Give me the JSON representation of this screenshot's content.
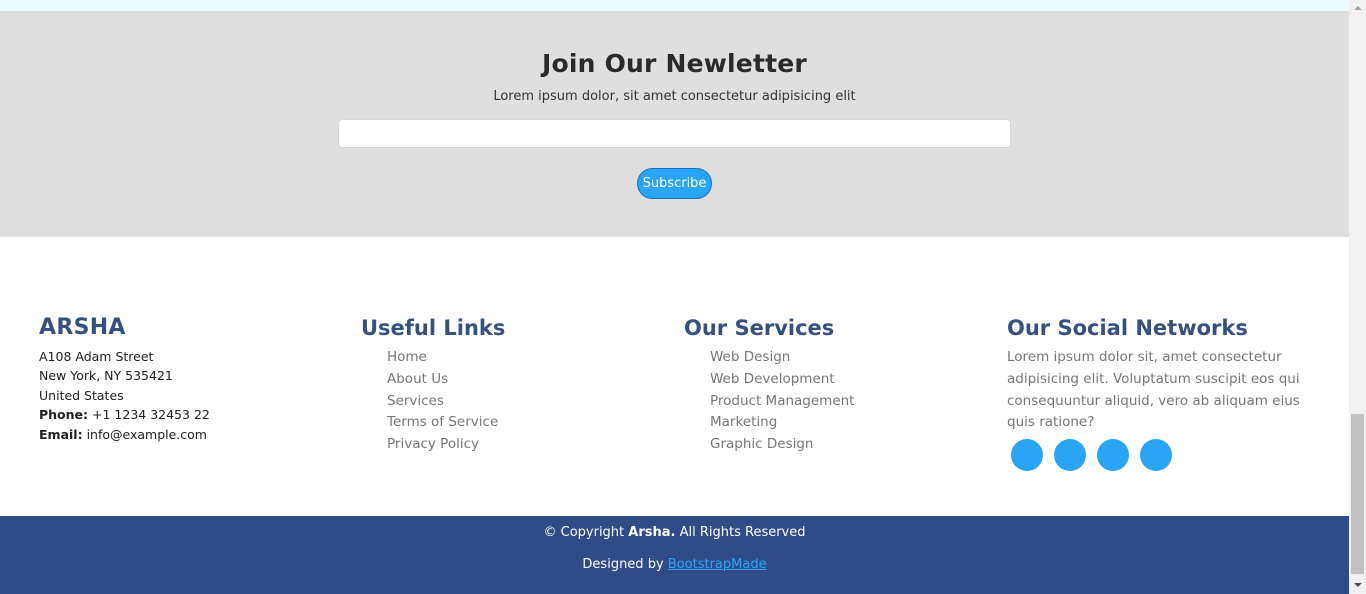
{
  "newsletter": {
    "title": "Join Our Newletter",
    "subtitle": "Lorem ipsum dolor, sit amet consectetur adipisicing elit",
    "input_value": "",
    "subscribe_label": "Subscribe"
  },
  "footer": {
    "brand": {
      "name": "ARSHA",
      "street": "A108 Adam Street",
      "city": "New York, NY 535421",
      "country": "United States",
      "phone_label": "Phone:",
      "phone": "+1 1234 32453 22",
      "email_label": "Email:",
      "email": "info@example.com"
    },
    "useful_links": {
      "heading": "Useful Links",
      "items": [
        "Home",
        "About Us",
        "Services",
        "Terms of Service",
        "Privacy Policy"
      ]
    },
    "services": {
      "heading": "Our Services",
      "items": [
        "Web Design",
        "Web Development",
        "Product Management",
        "Marketing",
        "Graphic Design"
      ]
    },
    "social": {
      "heading": "Our Social Networks",
      "text": "Lorem ipsum dolor sit, amet consectetur adipisicing elit. Voluptatum suscipit eos qui consequuntur aliquid, vero ab aliquam eius quis ratione?",
      "icons": [
        "social-icon-1",
        "social-icon-2",
        "social-icon-3",
        "social-icon-4"
      ]
    }
  },
  "bottom": {
    "copyright_prefix": "© Copyright",
    "copyright_brand": "Arsha.",
    "copyright_suffix": "All Rights Reserved",
    "designed_by": "Designed by",
    "designer_link": "BootstrapMade"
  },
  "colors": {
    "accent": "#2aa4f4",
    "brand": "#37517e",
    "footer_bottom": "#2f4c88",
    "newsletter_bg": "#dfdfdf"
  }
}
